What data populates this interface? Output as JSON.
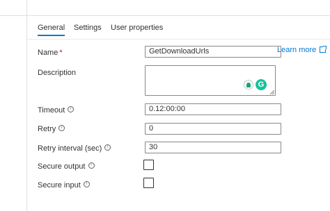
{
  "tabs": [
    {
      "label": "General"
    },
    {
      "label": "Settings"
    },
    {
      "label": "User properties"
    }
  ],
  "learn_more": {
    "label": "Learn more"
  },
  "form": {
    "name": {
      "label": "Name",
      "required_mark": "*",
      "value": "GetDownloadUrls"
    },
    "description": {
      "label": "Description",
      "value": ""
    },
    "timeout": {
      "label": "Timeout",
      "value": "0.12:00:00"
    },
    "retry": {
      "label": "Retry",
      "value": "0"
    },
    "retry_interval": {
      "label": "Retry interval (sec)",
      "value": "30"
    },
    "secure_output": {
      "label": "Secure output",
      "checked": false
    },
    "secure_input": {
      "label": "Secure input",
      "checked": false
    }
  },
  "icons": {
    "info": "i",
    "grammarly": "G",
    "external_link": "external-link-icon"
  },
  "colors": {
    "accent": "#0078d4",
    "required": "#a4262c",
    "grammarly": "#15c39a"
  }
}
